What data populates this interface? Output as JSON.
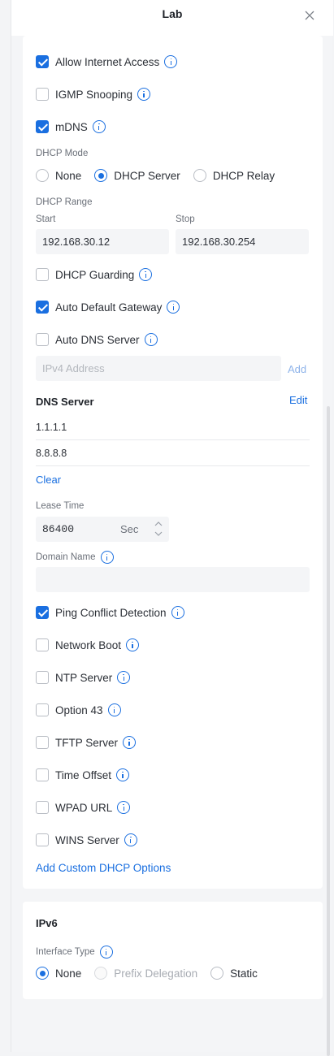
{
  "header": {
    "title": "Lab"
  },
  "options_top": [
    {
      "label": "Allow Internet Access",
      "checked": true,
      "info": true
    },
    {
      "label": "IGMP Snooping",
      "checked": false,
      "info": true
    },
    {
      "label": "mDNS",
      "checked": true,
      "info": true
    }
  ],
  "dhcp_mode": {
    "label": "DHCP Mode",
    "options": [
      "None",
      "DHCP Server",
      "DHCP Relay"
    ],
    "selected": "DHCP Server"
  },
  "dhcp_range": {
    "label": "DHCP Range",
    "start_label": "Start",
    "stop_label": "Stop",
    "start": "192.168.30.12",
    "stop": "192.168.30.254"
  },
  "options_mid": [
    {
      "label": "DHCP Guarding",
      "checked": false
    },
    {
      "label": "Auto Default Gateway",
      "checked": true
    },
    {
      "label": "Auto DNS Server",
      "checked": false
    }
  ],
  "dns_input": {
    "placeholder": "IPv4 Address",
    "add_label": "Add"
  },
  "dns_server": {
    "title": "DNS Server",
    "edit_label": "Edit",
    "entries": [
      "1.1.1.1",
      "8.8.8.8"
    ],
    "clear_label": "Clear"
  },
  "lease_time": {
    "label": "Lease Time",
    "value": "86400",
    "unit": "Sec"
  },
  "domain_name": {
    "label": "Domain Name",
    "value": ""
  },
  "options_bottom": [
    {
      "label": "Ping Conflict Detection",
      "checked": true
    },
    {
      "label": "Network Boot",
      "checked": false
    },
    {
      "label": "NTP Server",
      "checked": false
    },
    {
      "label": "Option 43",
      "checked": false
    },
    {
      "label": "TFTP Server",
      "checked": false
    },
    {
      "label": "Time Offset",
      "checked": false
    },
    {
      "label": "WPAD URL",
      "checked": false
    },
    {
      "label": "WINS Server",
      "checked": false
    }
  ],
  "add_custom_label": "Add Custom DHCP Options",
  "ipv6": {
    "title": "IPv6",
    "interface_type_label": "Interface Type",
    "options": [
      "None",
      "Prefix Delegation",
      "Static"
    ],
    "selected": "None",
    "disabled": [
      "Prefix Delegation"
    ]
  },
  "colors": {
    "accent": "#1a6fe0",
    "panel_bg": "#f4f5f7",
    "card_bg": "#ffffff"
  }
}
